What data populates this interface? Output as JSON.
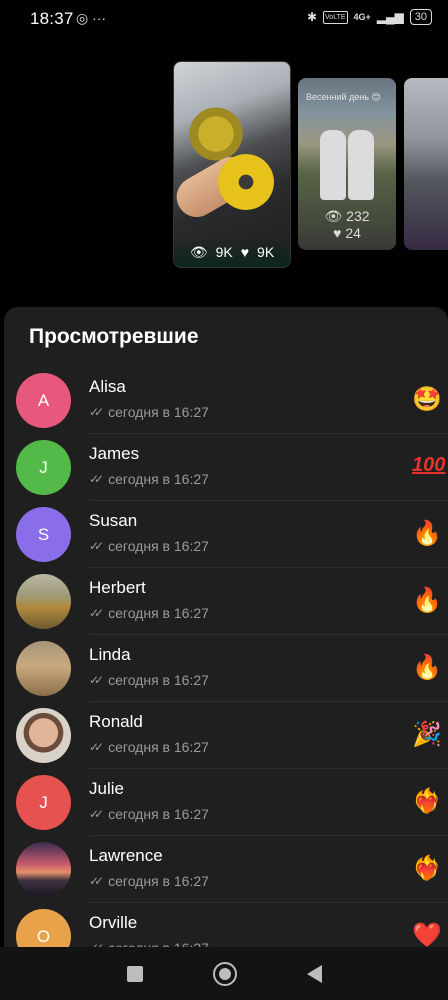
{
  "status_bar": {
    "time": "18:37",
    "left_icons": "◎ ···",
    "bluetooth": "✱",
    "volte": "VoLTE",
    "network": "4G+",
    "signal": "▂▄▆",
    "battery": "30"
  },
  "stories": [
    {
      "views": "9K",
      "likes": "9K"
    },
    {
      "views": "232",
      "likes": "24",
      "caption": "Весенний день 😊"
    },
    {}
  ],
  "sheet": {
    "title": "Просмотревшие",
    "viewers": [
      {
        "name": "Alisa",
        "initial": "A",
        "time": "сегодня в 16:27",
        "avatar_color": "#e7577e",
        "reaction": "🤩"
      },
      {
        "name": "James",
        "initial": "J",
        "time": "сегодня в 16:27",
        "avatar_color": "#53b948",
        "reaction": "💯"
      },
      {
        "name": "Susan",
        "initial": "S",
        "time": "сегодня в 16:27",
        "avatar_color": "#8a6ee9",
        "reaction": "🔥"
      },
      {
        "name": "Herbert",
        "initial": "",
        "time": "сегодня в 16:27",
        "avatar_color": "#8a7a4a",
        "reaction": "🔥"
      },
      {
        "name": "Linda",
        "initial": "",
        "time": "сегодня в 16:27",
        "avatar_color": "#a88b6a",
        "reaction": "🔥"
      },
      {
        "name": "Ronald",
        "initial": "",
        "time": "сегодня в 16:27",
        "avatar_color": "#c29a7c",
        "reaction": "🎉"
      },
      {
        "name": "Julie",
        "initial": "J",
        "time": "сегодня в 16:27",
        "avatar_color": "#e5524f",
        "reaction": "❤️‍🔥"
      },
      {
        "name": "Lawrence",
        "initial": "",
        "time": "сегодня в 16:27",
        "avatar_color": "#7a3c55",
        "reaction": "❤️‍🔥"
      },
      {
        "name": "Orville",
        "initial": "O",
        "time": "сегодня в 16:27",
        "avatar_color": "#e8a34a",
        "reaction": "❤️"
      }
    ]
  },
  "navbar": {
    "items": [
      "square-button",
      "home-button",
      "back-button"
    ]
  }
}
